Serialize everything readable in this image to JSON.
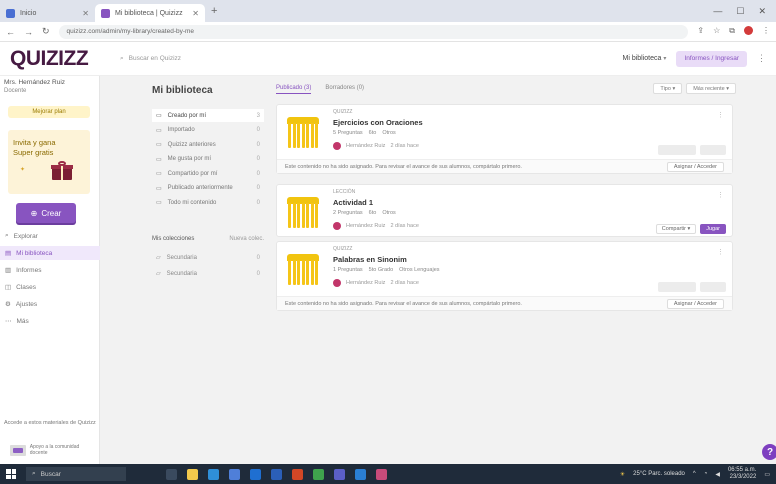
{
  "browser": {
    "tabs": [
      {
        "label": "Inicio",
        "active": false
      },
      {
        "label": "Mi biblioteca | Quizizz",
        "active": true
      }
    ],
    "url": "quizizz.com/admin/my-library/created-by-me"
  },
  "app": {
    "logo": "QUIZIZZ",
    "search_placeholder": "Buscar en Quizizz",
    "nav_library": "Mi biblioteca",
    "create_button": "Informes / Ingresar"
  },
  "sidebar": {
    "user_name": "Mrs. Hernández Ruiz",
    "user_role": "Docente",
    "plan_button": "Mejorar plan",
    "promo": "Invita y gana Super gratis",
    "create_label": "Crear",
    "nav": [
      {
        "icon": "search-icon",
        "label": "Explorar",
        "glyph": "⌕",
        "active": false
      },
      {
        "icon": "library-icon",
        "label": "Mi biblioteca",
        "glyph": "▤",
        "active": true
      },
      {
        "icon": "reports-icon",
        "label": "Informes",
        "glyph": "▥",
        "active": false
      },
      {
        "icon": "classes-icon",
        "label": "Clases",
        "glyph": "◫",
        "active": false
      },
      {
        "icon": "settings-icon",
        "label": "Ajustes",
        "glyph": "⚙",
        "active": false
      },
      {
        "icon": "help-icon",
        "label": "Más",
        "glyph": "⋯",
        "active": false
      }
    ],
    "footer_text": "Accede a estos materiales de Quizizz",
    "footer_partner": "Apoyo a la comunidad docente"
  },
  "main": {
    "title": "Mi biblioteca",
    "filters": [
      {
        "label": "Creado por mí",
        "count": "3",
        "active": true
      },
      {
        "label": "Importado",
        "count": "0",
        "active": false
      },
      {
        "label": "Quizizz anteriores",
        "count": "0",
        "active": false
      },
      {
        "label": "Me gusta por mí",
        "count": "0",
        "active": false
      },
      {
        "label": "Compartido por mí",
        "count": "0",
        "active": false
      },
      {
        "label": "Publicado anteriormente",
        "count": "0",
        "active": false
      },
      {
        "label": "Todo mi contenido",
        "count": "0",
        "active": false
      }
    ],
    "collections_title": "Mis colecciones",
    "new_collection": "Nueva colec.",
    "collections": [
      {
        "label": "Secundaria",
        "count": "0"
      },
      {
        "label": "Secundaria",
        "count": "0"
      }
    ],
    "tabs": [
      {
        "label": "Publicado (3)",
        "active": true
      },
      {
        "label": "Borradores (0)",
        "active": false
      }
    ],
    "tools": [
      "Tipo ▾",
      "Más reciente ▾"
    ],
    "cards": [
      {
        "type": "QUIZIZZ",
        "title": "Ejercicios con Oraciones",
        "questions": "5 Preguntas",
        "grade": "6to",
        "subject": "Otros",
        "author": "Hernández Ruiz",
        "age": "2 días hace",
        "footer": "Este contenido no ha sido asignado. Para revisar el avance de sus alumnos, compártalo primero.",
        "footer_button": "Asignar / Acceder",
        "actions": []
      },
      {
        "type": "LECCIÓN",
        "title": "Actividad 1",
        "questions": "2 Preguntas",
        "grade": "6to",
        "subject": "Otros",
        "author": "Hernández Ruiz",
        "age": "2 días hace",
        "footer": "",
        "footer_button": "",
        "actions": [
          "Compartir ▾",
          "Jugar"
        ]
      },
      {
        "type": "QUIZIZZ",
        "title": "Palabras en Sinonim",
        "questions": "1 Preguntas",
        "grade": "5to Grado",
        "subject": "Otros Lenguajes",
        "author": "Hernández Ruiz",
        "age": "2 días hace",
        "footer": "Este contenido no ha sido asignado. Para revisar el avance de sus alumnos, compártalo primero.",
        "footer_button": "Asignar / Acceder",
        "actions": []
      }
    ]
  },
  "taskbar": {
    "search": "Buscar",
    "tray_status": "25°C Parc. soleado",
    "time": "06:55 a.m.",
    "date": "23/3/2022"
  }
}
